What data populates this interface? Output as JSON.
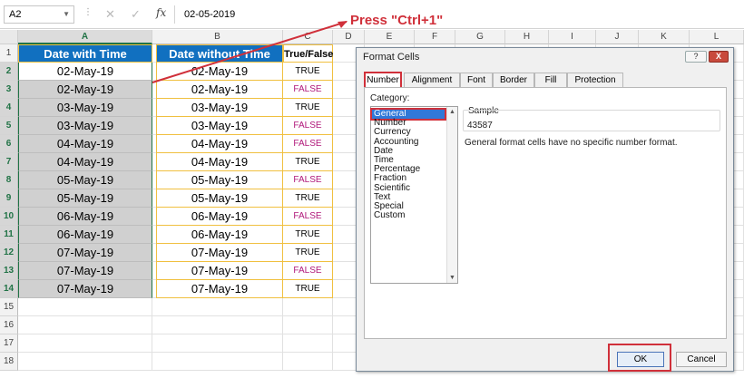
{
  "formula_bar": {
    "name_box": "A2",
    "formula_value": "02-05-2019",
    "icons": [
      "cancel-icon",
      "enter-icon",
      "function-icon"
    ]
  },
  "columns": [
    "A",
    "B",
    "C",
    "D",
    "E",
    "F",
    "G",
    "H",
    "I",
    "J",
    "K",
    "L"
  ],
  "rows": [
    "1",
    "2",
    "3",
    "4",
    "5",
    "6",
    "7",
    "8",
    "9",
    "10",
    "11",
    "12",
    "13",
    "14",
    "15",
    "16",
    "17",
    "18"
  ],
  "table": {
    "headers": [
      "Date with Time",
      "Date without Time",
      "True/False"
    ],
    "col_a": [
      "02-May-19",
      "02-May-19",
      "03-May-19",
      "03-May-19",
      "04-May-19",
      "04-May-19",
      "05-May-19",
      "05-May-19",
      "06-May-19",
      "06-May-19",
      "07-May-19",
      "07-May-19",
      "07-May-19"
    ],
    "col_b": [
      "02-May-19",
      "02-May-19",
      "03-May-19",
      "03-May-19",
      "04-May-19",
      "04-May-19",
      "05-May-19",
      "05-May-19",
      "06-May-19",
      "06-May-19",
      "07-May-19",
      "07-May-19",
      "07-May-19"
    ],
    "col_c": [
      "TRUE",
      "FALSE",
      "TRUE",
      "FALSE",
      "FALSE",
      "TRUE",
      "FALSE",
      "TRUE",
      "FALSE",
      "TRUE",
      "TRUE",
      "FALSE",
      "TRUE"
    ]
  },
  "annotation": {
    "text": "Press \"Ctrl+1\""
  },
  "dialog": {
    "title": "Format Cells",
    "help_label": "?",
    "close_label": "X",
    "tabs": [
      "Number",
      "Alignment",
      "Font",
      "Border",
      "Fill",
      "Protection"
    ],
    "category_label": "Category:",
    "categories": [
      "General",
      "Number",
      "Currency",
      "Accounting",
      "Date",
      "Time",
      "Percentage",
      "Fraction",
      "Scientific",
      "Text",
      "Special",
      "Custom"
    ],
    "sample_label": "Sample",
    "sample_value": "43587",
    "description": "General format cells have no specific number format.",
    "ok_label": "OK",
    "cancel_label": "Cancel"
  },
  "colors": {
    "header_blue": "#1170c0",
    "false_text": "#b0187a",
    "annotation_red": "#d0303a",
    "selection_green": "#217346"
  }
}
